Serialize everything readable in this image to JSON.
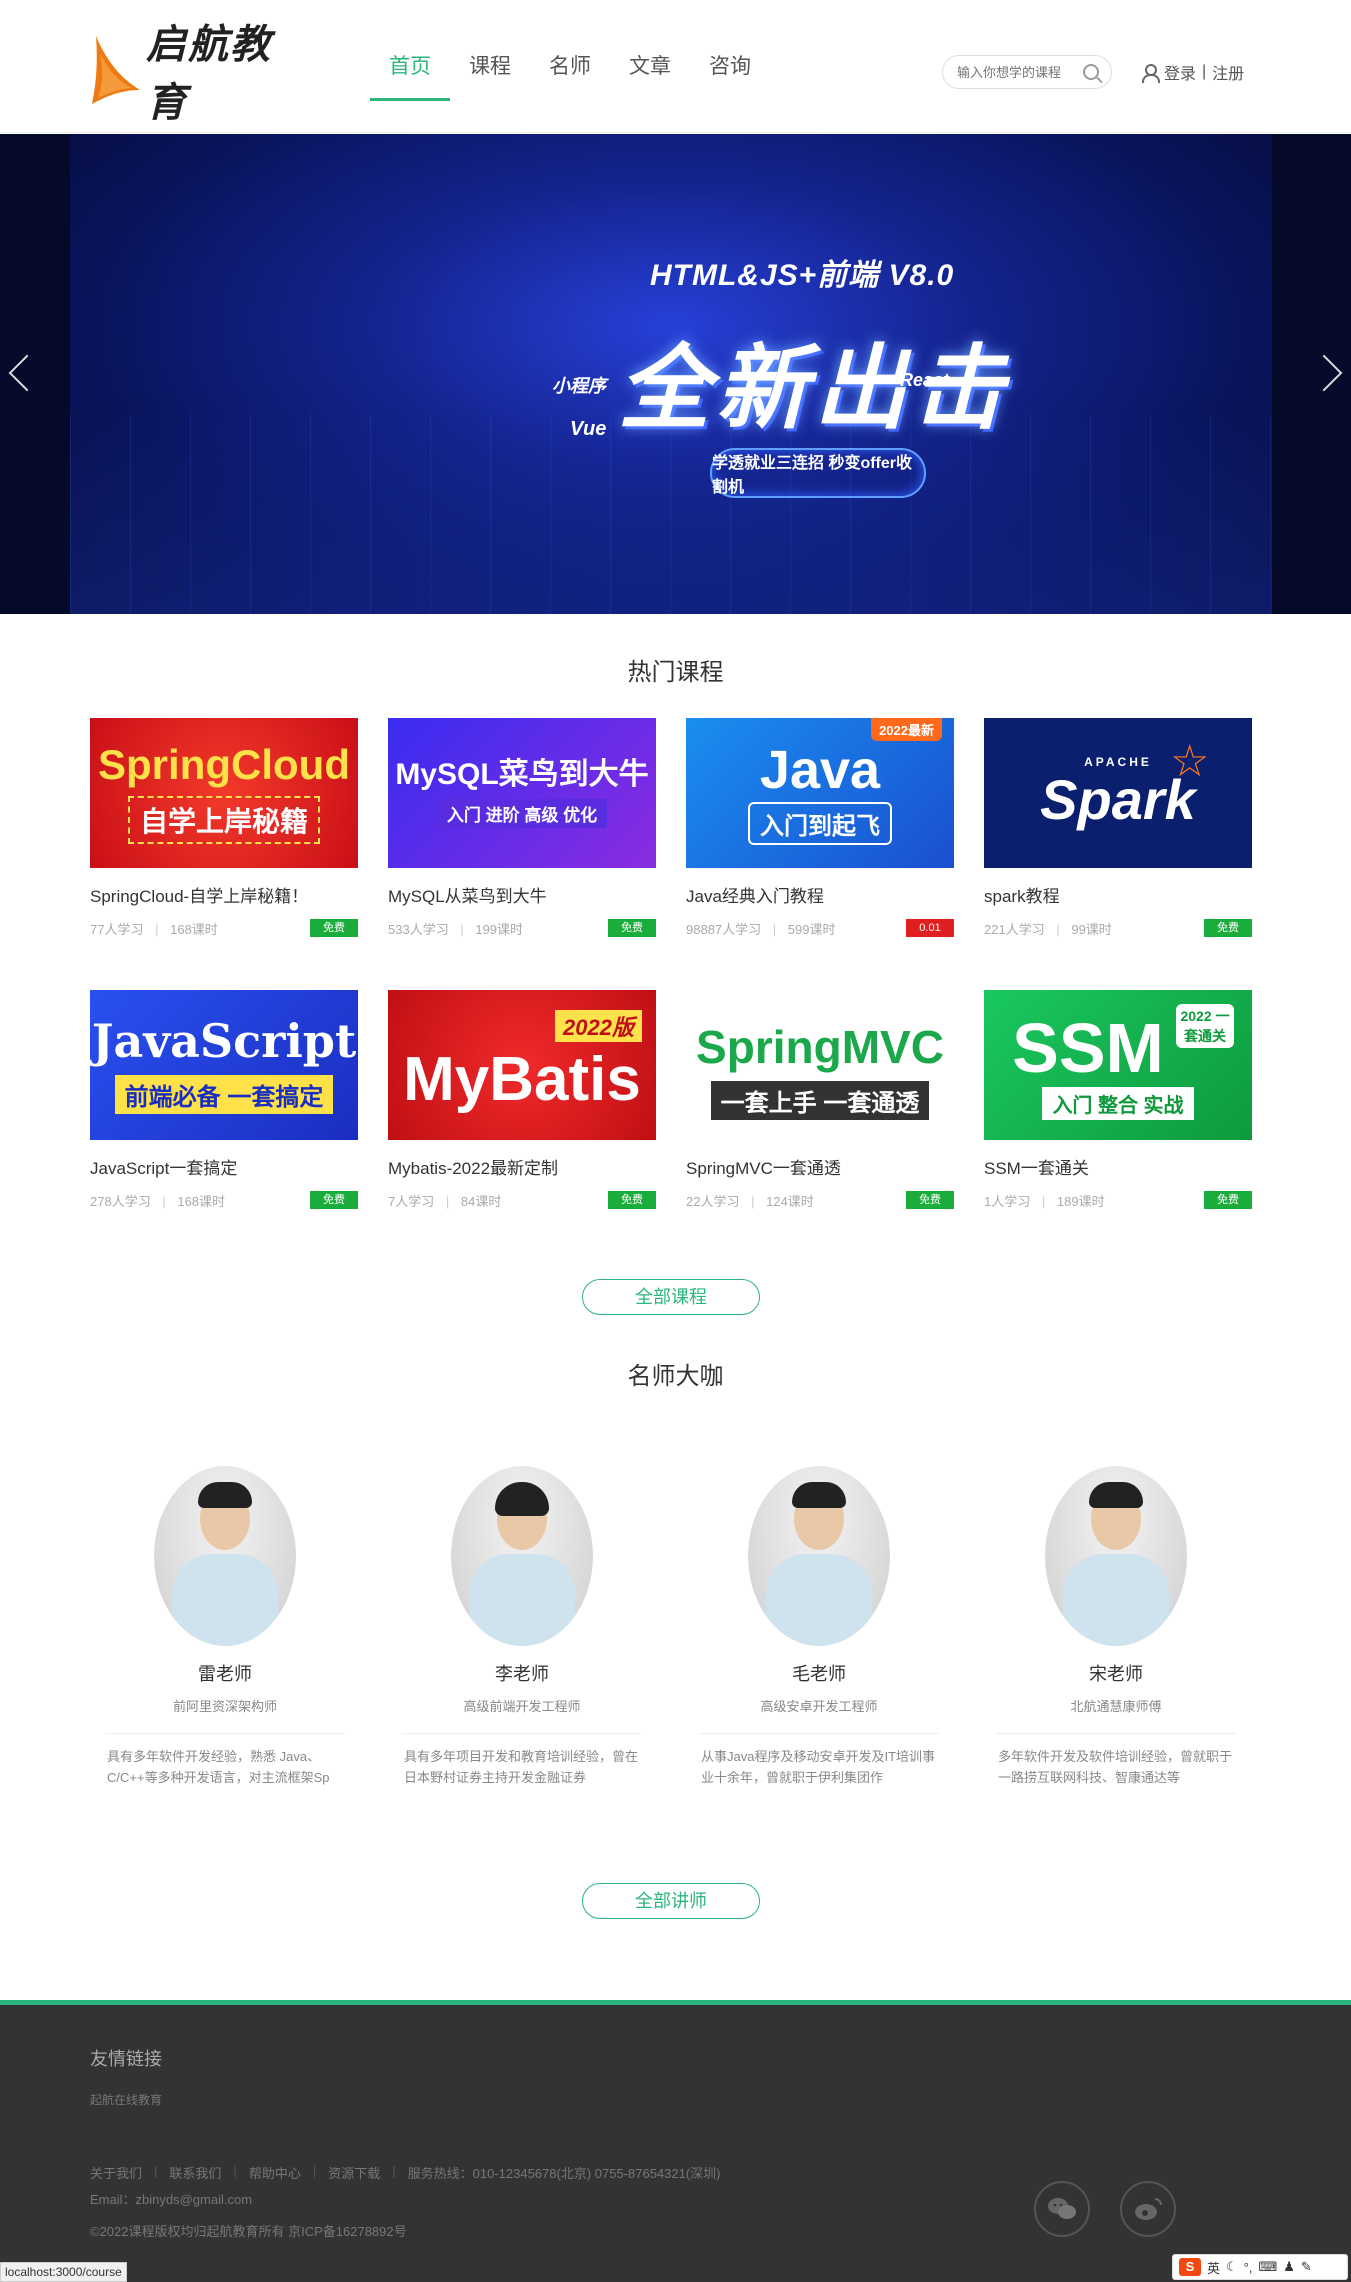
{
  "header": {
    "logo_text": "启航教育",
    "nav": [
      "首页",
      "课程",
      "名师",
      "文章",
      "咨询"
    ],
    "search_placeholder": "输入你想学的课程",
    "login": "登录",
    "separator": "|",
    "register": "注册"
  },
  "banner": {
    "title_small": "HTML&JS+前端 V8.0",
    "title_big": "全新出击",
    "tag_miniprogram": "小程序",
    "tag_vue": "Vue",
    "tag_react": "React",
    "pill": "学透就业三连招 秒变offer收割机"
  },
  "hot_courses": {
    "title": "热门课程",
    "courses": [
      {
        "thumb_main": "SpringCloud",
        "thumb_sub": "自学上岸秘籍",
        "name": "SpringCloud-自学上岸秘籍！",
        "learners": "77人学习",
        "lessons": "168课时",
        "price": "免费",
        "bg": "#d8141c",
        "price_color": "#1aad3b"
      },
      {
        "thumb_main": "MySQL菜鸟到大牛",
        "thumb_sub": "入门 进阶 高级 优化",
        "name": "MySQL从菜鸟到大牛",
        "learners": "533人学习",
        "lessons": "199课时",
        "price": "免费",
        "bg": "#5a2ce0",
        "price_color": "#1aad3b"
      },
      {
        "thumb_main": "Java",
        "thumb_sub": "入门到起飞",
        "name": "Java经典入门教程",
        "learners": "98887人学习",
        "lessons": "599课时",
        "price": "0.01",
        "bg": "#1a6fe0",
        "price_color": "#e02020",
        "corner": "2022最新"
      },
      {
        "thumb_main": "Spark",
        "thumb_sub": "APACHE",
        "name": "spark教程",
        "learners": "221人学习",
        "lessons": "99课时",
        "price": "免费",
        "bg": "#0a1f6e",
        "price_color": "#1aad3b"
      },
      {
        "thumb_main": "JavaScript",
        "thumb_sub": "前端必备 一套搞定",
        "name": "JavaScript一套搞定",
        "learners": "278人学习",
        "lessons": "168课时",
        "price": "免费",
        "bg": "#1c3fd6",
        "price_color": "#1aad3b"
      },
      {
        "thumb_main": "MyBatis",
        "thumb_sub": "2022版",
        "name": "Mybatis-2022最新定制",
        "learners": "7人学习",
        "lessons": "84课时",
        "price": "免费",
        "bg": "#d91a1a",
        "price_color": "#1aad3b"
      },
      {
        "thumb_main": "SpringMVC",
        "thumb_sub": "一套上手 一套通透",
        "name": "SpringMVC一套通透",
        "learners": "22人学习",
        "lessons": "124课时",
        "price": "免费",
        "bg": "#ffffff",
        "price_color": "#1aad3b"
      },
      {
        "thumb_main": "SSM",
        "thumb_sub": "入门 整合 实战",
        "name": "SSM一套通关",
        "learners": "1人学习",
        "lessons": "189课时",
        "price": "免费",
        "bg": "#14a84a",
        "price_color": "#1aad3b",
        "corner": "2022 一套通关"
      }
    ],
    "all_button": "全部课程"
  },
  "teachers": {
    "title": "名师大咖",
    "list": [
      {
        "name": "雷老师",
        "title": "前阿里资深架构师",
        "desc": "具有多年软件开发经验，熟悉 Java、C/C++等多种开发语言，对主流框架Sp"
      },
      {
        "name": "李老师",
        "title": "高级前端开发工程师",
        "desc": "具有多年项目开发和教育培训经验，曾在日本野村证券主持开发金融证券"
      },
      {
        "name": "毛老师",
        "title": "高级安卓开发工程师",
        "desc": "从事Java程序及移动安卓开发及IT培训事业十余年，曾就职于伊利集团作"
      },
      {
        "name": "宋老师",
        "title": "北航通慧康师傅",
        "desc": "多年软件开发及软件培训经验，曾就职于一路捞互联网科技、智康通达等"
      }
    ],
    "all_button": "全部讲师"
  },
  "footer": {
    "friend_links_title": "友情链接",
    "friend_link": "起航在线教育",
    "nav": [
      "关于我们",
      "联系我们",
      "帮助中心",
      "资源下载",
      "服务热线：010-12345678(北京) 0755-87654321(深圳)"
    ],
    "email": "Email：zbinyds@gmail.com",
    "copyright": "©2022课程版权均归起航教育所有 京ICP备16278892号"
  },
  "status_url": "localhost:3000/course",
  "ime": {
    "lang": "英",
    "s": "S"
  }
}
